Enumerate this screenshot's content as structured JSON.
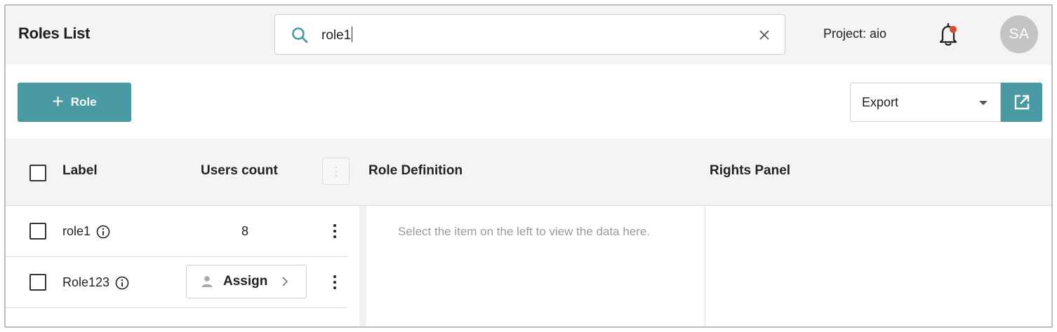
{
  "header": {
    "title": "Roles List",
    "search": {
      "value": "role1",
      "clear_icon": "close-icon",
      "search_icon": "search-icon"
    },
    "project_label": "Project: aio",
    "notification_icon": "bell-icon",
    "avatar_initials": "SA"
  },
  "toolbar": {
    "add_button_label": "Role",
    "export": {
      "selected": "Export"
    },
    "open_icon": "external-link-icon"
  },
  "table": {
    "columns": [
      "Label",
      "Users count",
      "Role Definition",
      "Rights Panel"
    ],
    "rows": [
      {
        "label": "role1",
        "users_count": "8"
      },
      {
        "label": "Role123",
        "action_label": "Assign"
      }
    ],
    "detail_placeholder": "Select the item on the left to view the data here."
  },
  "colors": {
    "accent": "#4a9aa4",
    "header_bg": "#f4f4f4",
    "notification_dot": "#e0452e"
  }
}
